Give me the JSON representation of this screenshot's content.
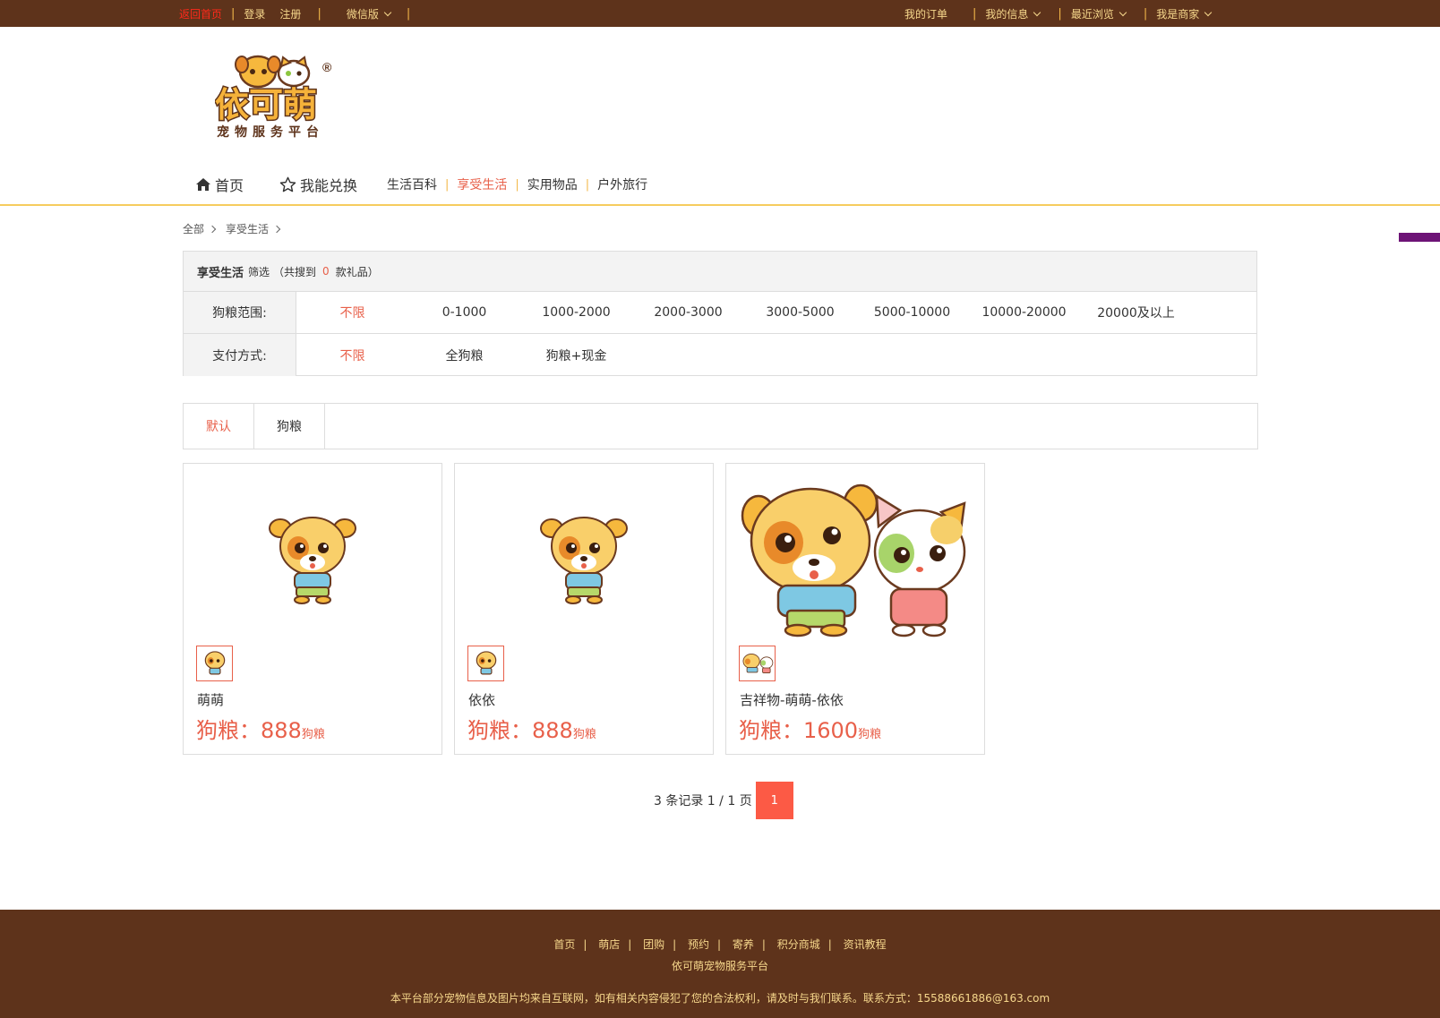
{
  "topbar": {
    "back_home": "返回首页",
    "login": "登录",
    "register": "注册",
    "wechat": "微信版",
    "my_orders": "我的订单",
    "my_info": "我的信息",
    "recent": "最近浏览",
    "merchant": "我是商家"
  },
  "logo": {
    "brand": "依可萌",
    "tagline": "宠物服务平台",
    "reg": "®"
  },
  "nav": {
    "home": "首页",
    "exchange": "我能兑换",
    "categories": [
      "生活百科",
      "享受生活",
      "实用物品",
      "户外旅行"
    ],
    "active_category": "享受生活"
  },
  "breadcrumb": [
    "全部",
    "享受生活"
  ],
  "filter": {
    "title": "享受生活",
    "filter_word": "筛选",
    "count_prefix": "（共搜到",
    "count": "0",
    "count_suffix": "款礼品）",
    "rows": [
      {
        "label": "狗粮范围:",
        "options": [
          "不限",
          "0-1000",
          "1000-2000",
          "2000-3000",
          "3000-5000",
          "5000-10000",
          "10000-20000",
          "20000及以上"
        ]
      },
      {
        "label": "支付方式:",
        "options": [
          "不限",
          "全狗粮",
          "狗粮+现金"
        ]
      }
    ]
  },
  "sort": [
    "默认",
    "狗粮"
  ],
  "products": [
    {
      "name": "萌萌",
      "price_label": "狗粮：",
      "price": "888",
      "unit": "狗粮"
    },
    {
      "name": "依依",
      "price_label": "狗粮：",
      "price": "888",
      "unit": "狗粮"
    },
    {
      "name": "吉祥物-萌萌-依依",
      "price_label": "狗粮：",
      "price": "1600",
      "unit": "狗粮"
    }
  ],
  "pager": {
    "summary": "3 条记录 1 / 1 页",
    "current": "1"
  },
  "footer": {
    "links": [
      "首页",
      "萌店",
      "团购",
      "预约",
      "寄养",
      "积分商城",
      "资讯教程"
    ],
    "site_name": "依可萌宠物服务平台",
    "notice": "本平台部分宠物信息及图片均来自互联网，如有相关内容侵犯了您的合法权利，请及时与我们联系。联系方式：15588661886@163.com"
  },
  "colors": {
    "brown": "#5e331b",
    "gold": "#f7d88c",
    "accent": "#e8604a",
    "page_button": "#fc5a45"
  }
}
